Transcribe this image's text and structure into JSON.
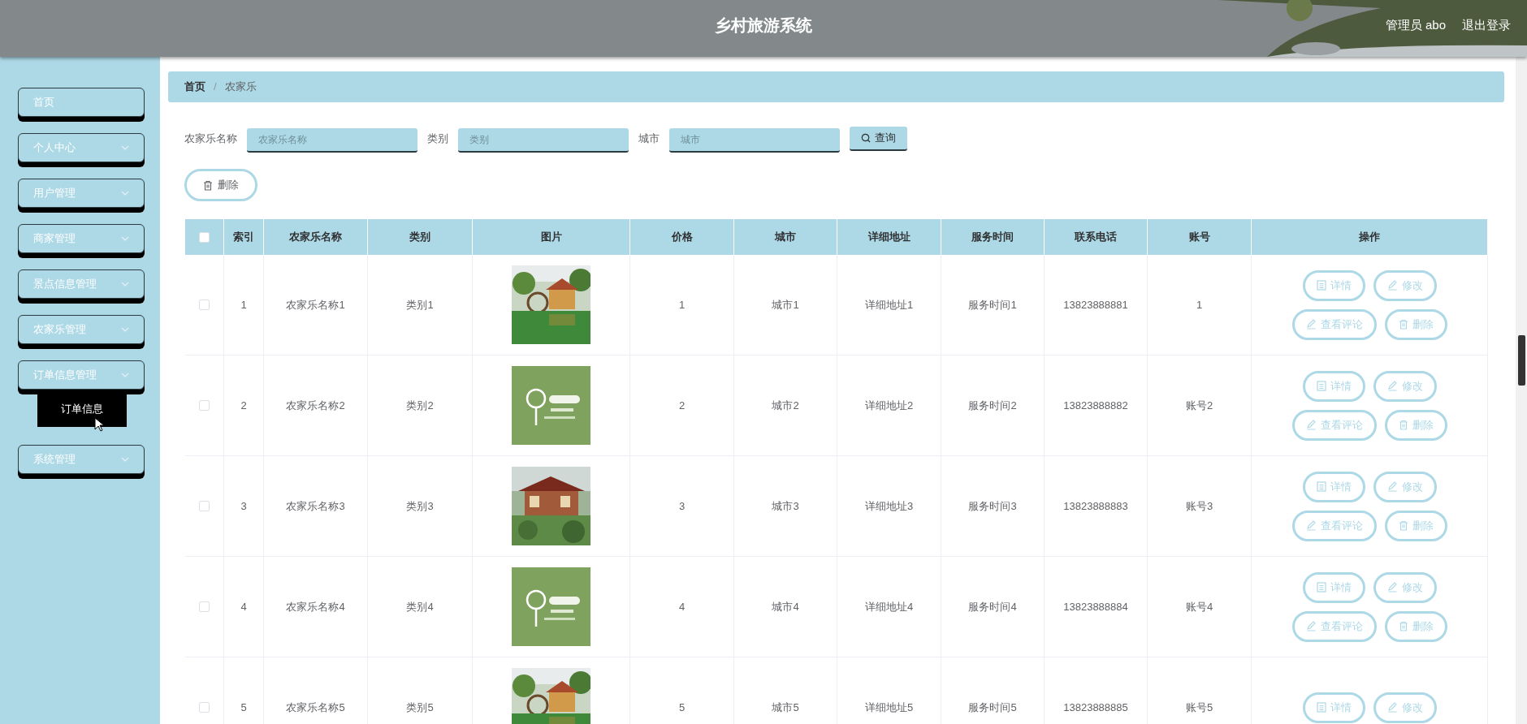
{
  "header": {
    "title": "乡村旅游系统",
    "user": "管理员 abo",
    "logout": "退出登录"
  },
  "sidebar": {
    "items": [
      {
        "label": "首页",
        "kind": "link"
      },
      {
        "label": "个人中心",
        "kind": "menu"
      },
      {
        "label": "用户管理",
        "kind": "menu"
      },
      {
        "label": "商家管理",
        "kind": "menu"
      },
      {
        "label": "景点信息管理",
        "kind": "menu"
      },
      {
        "label": "农家乐管理",
        "kind": "menu"
      },
      {
        "label": "订单信息管理",
        "kind": "menu",
        "children": [
          {
            "label": "订单信息"
          }
        ]
      },
      {
        "label": "系统管理",
        "kind": "menu"
      }
    ]
  },
  "breadcrumb": {
    "items": [
      "首页",
      "农家乐"
    ],
    "separator": "/"
  },
  "search": {
    "fields": [
      {
        "label": "农家乐名称",
        "placeholder": "农家乐名称"
      },
      {
        "label": "类别",
        "placeholder": "类别"
      },
      {
        "label": "城市",
        "placeholder": "城市"
      }
    ],
    "button": "查询"
  },
  "delete_button": "删除",
  "table": {
    "columns": [
      "索引",
      "农家乐名称",
      "类别",
      "图片",
      "价格",
      "城市",
      "详细地址",
      "服务时间",
      "联系电话",
      "账号",
      "操作"
    ],
    "header_checked": false,
    "rows": [
      {
        "checked": false,
        "cells": [
          "1",
          "农家乐名称1",
          "类别1",
          {
            "kind": "picture"
          },
          "1",
          "城市1",
          "详细地址1",
          "服务时间1",
          "13823888881",
          "1"
        ],
        "actions": [
          "详情",
          "修改",
          "查看评论",
          "删除"
        ]
      },
      {
        "checked": false,
        "cells": [
          "2",
          "农家乐名称2",
          "类别2",
          {
            "kind": "picture"
          },
          "2",
          "城市2",
          "详细地址2",
          "服务时间2",
          "13823888882",
          "账号2"
        ],
        "actions": [
          "详情",
          "修改",
          "查看评论",
          "删除"
        ]
      },
      {
        "checked": false,
        "cells": [
          "3",
          "农家乐名称3",
          "类别3",
          {
            "kind": "picture"
          },
          "3",
          "城市3",
          "详细地址3",
          "服务时间3",
          "13823888883",
          "账号3"
        ],
        "actions": [
          "详情",
          "修改",
          "查看评论",
          "删除"
        ]
      },
      {
        "checked": false,
        "cells": [
          "4",
          "农家乐名称4",
          "类别4",
          {
            "kind": "picture"
          },
          "4",
          "城市4",
          "详细地址4",
          "服务时间4",
          "13823888884",
          "账号4"
        ],
        "actions": [
          "详情",
          "修改",
          "查看评论",
          "删除"
        ]
      },
      {
        "checked": false,
        "cells": [
          "5",
          "农家乐名称5",
          "类别5",
          {
            "kind": "picture"
          },
          "5",
          "城市5",
          "详细地址5",
          "服务时间5",
          "13823888885",
          "账号5"
        ],
        "actions": [
          "详情",
          "修改"
        ]
      }
    ]
  }
}
